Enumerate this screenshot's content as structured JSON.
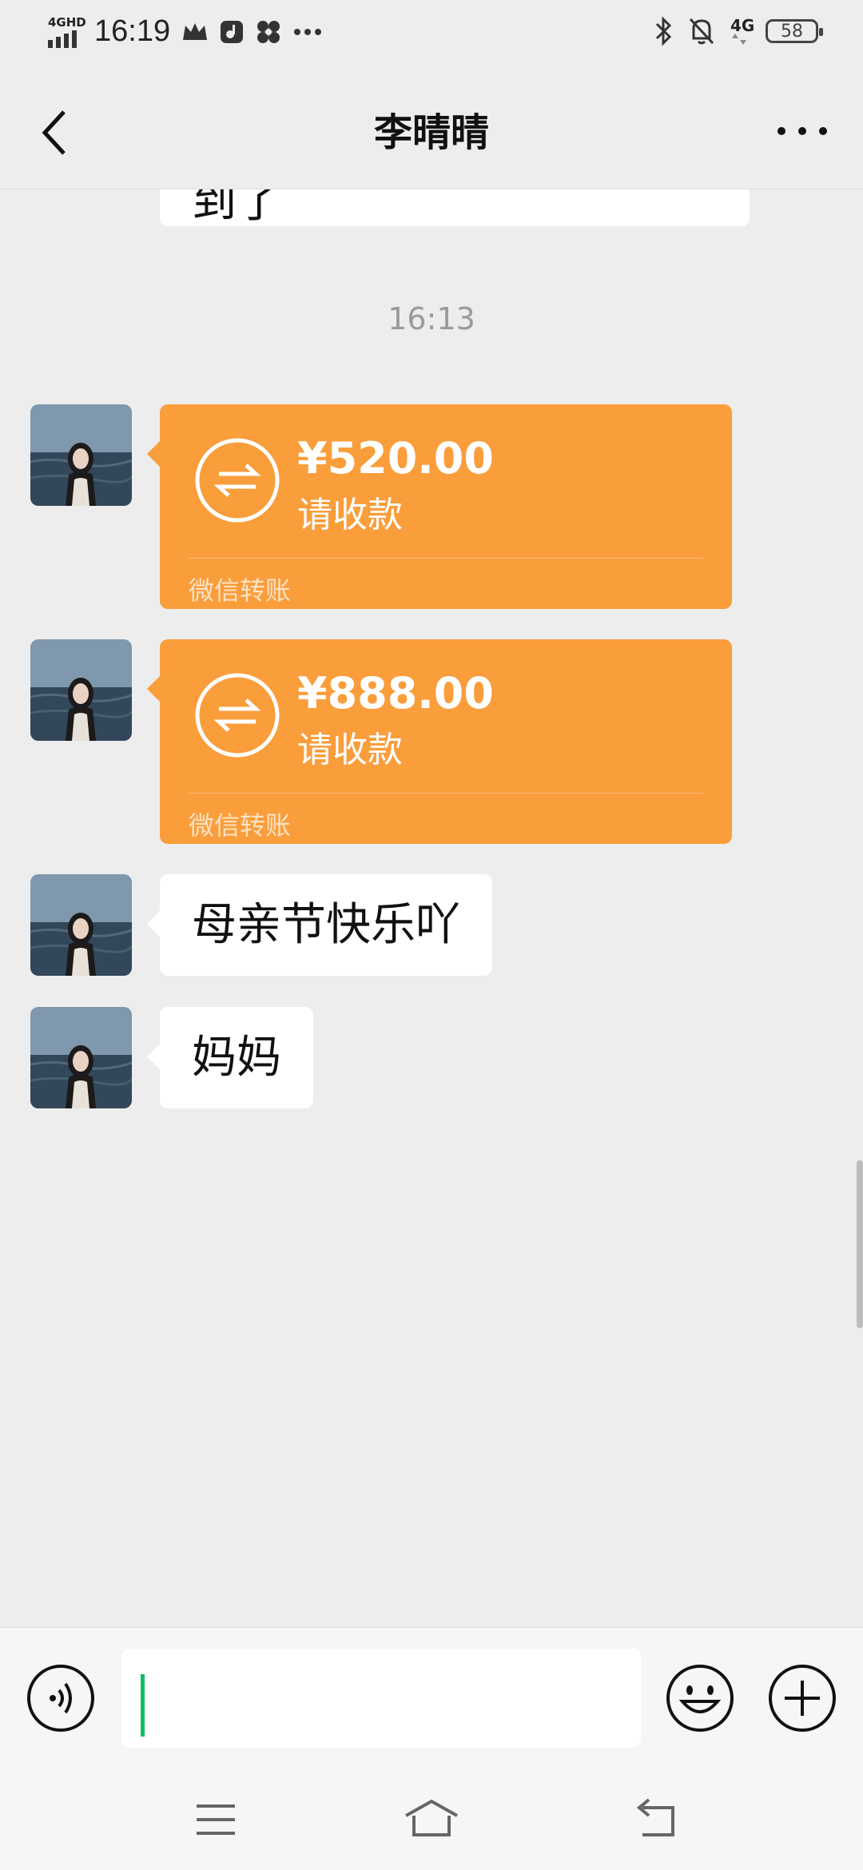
{
  "status_bar": {
    "time": "16:19",
    "network_left": "4GHD",
    "network_right": "4G",
    "battery": "58"
  },
  "header": {
    "title": "李晴晴"
  },
  "messages": {
    "partial_text": "到了",
    "timestamp": "16:13",
    "transfers": [
      {
        "amount": "¥520.00",
        "label": "请收款",
        "footer": "微信转账"
      },
      {
        "amount": "¥888.00",
        "label": "请收款",
        "footer": "微信转账"
      }
    ],
    "texts": [
      "母亲节快乐吖",
      "妈妈"
    ]
  },
  "input": {
    "value": "",
    "accent_color": "#07c160"
  },
  "colors": {
    "background": "#ededed",
    "transfer": "#fa9d3b"
  },
  "icons": [
    "back-icon",
    "more-icon",
    "transfer-arrows-icon",
    "voice-icon",
    "emoji-icon",
    "plus-icon",
    "menu-icon",
    "home-icon",
    "back-nav-icon"
  ]
}
